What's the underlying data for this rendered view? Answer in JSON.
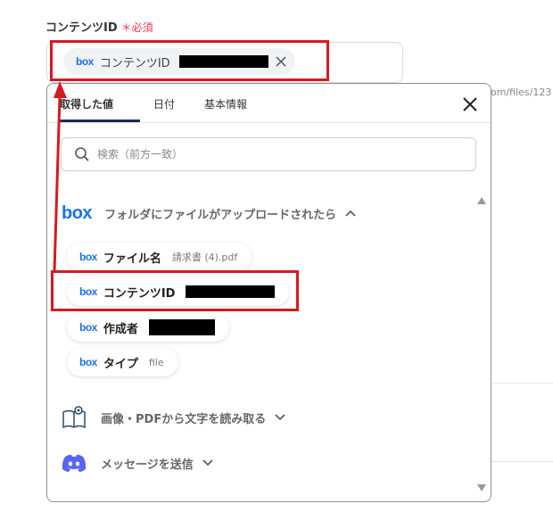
{
  "field": {
    "label": "コンテンツID",
    "required_mark": "＊必須",
    "chip_brand": "box",
    "chip_label": "コンテンツID"
  },
  "background": {
    "url_fragment": "om/files/123"
  },
  "popup": {
    "tabs": [
      "取得した値",
      "日付",
      "基本情報"
    ],
    "active_tab": 0,
    "search_placeholder": "検索（前方一致）",
    "sections": [
      {
        "brand": "box",
        "title": "フォルダにファイルがアップロードされたら",
        "expanded": true,
        "items": [
          {
            "name": "ファイル名",
            "value": "請求書 (4).pdf"
          },
          {
            "name": "コンテンツID",
            "value": ""
          },
          {
            "name": "作成者",
            "value": ""
          },
          {
            "name": "タイプ",
            "value": "file"
          }
        ]
      },
      {
        "icon": "book-ocr-icon",
        "title": "画像・PDFから文字を読み取る",
        "expanded": false
      },
      {
        "icon": "discord-icon",
        "title": "メッセージを送信",
        "expanded": false
      }
    ]
  },
  "colors": {
    "highlight": "#d71920",
    "box_brand": "#1a73e8",
    "required": "#e8394b",
    "tab_underline": "#1a2b59",
    "discord": "#5865f2"
  }
}
